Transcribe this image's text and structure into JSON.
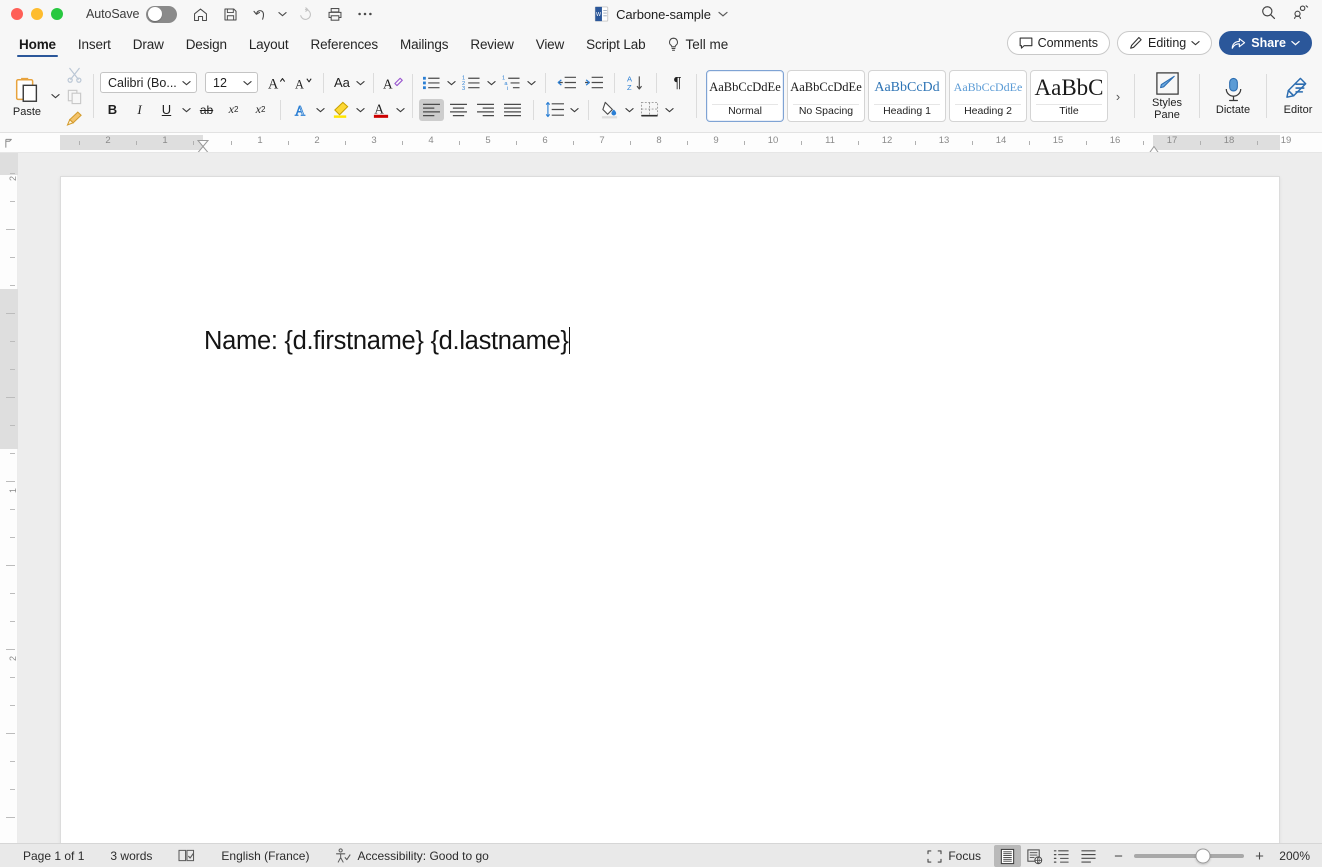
{
  "titlebar": {
    "autosave_label": "AutoSave",
    "autosave_state": "off",
    "document_title": "Carbone-sample",
    "quick_access": [
      {
        "name": "home-icon",
        "label": "Home"
      },
      {
        "name": "save-icon",
        "label": "Save"
      },
      {
        "name": "undo-icon",
        "label": "Undo"
      },
      {
        "name": "redo-icon",
        "label": "Redo"
      },
      {
        "name": "print-icon",
        "label": "Print"
      },
      {
        "name": "more-options-icon",
        "label": "More"
      }
    ],
    "search_label": "Search",
    "account_label": "Account"
  },
  "tabs": [
    {
      "label": "Home",
      "active": true
    },
    {
      "label": "Insert",
      "active": false
    },
    {
      "label": "Draw",
      "active": false
    },
    {
      "label": "Design",
      "active": false
    },
    {
      "label": "Layout",
      "active": false
    },
    {
      "label": "References",
      "active": false
    },
    {
      "label": "Mailings",
      "active": false
    },
    {
      "label": "Review",
      "active": false
    },
    {
      "label": "View",
      "active": false
    },
    {
      "label": "Script Lab",
      "active": false
    }
  ],
  "tellme": {
    "label": "Tell me"
  },
  "header_actions": {
    "comments_label": "Comments",
    "editing_label": "Editing",
    "share_label": "Share",
    "share_color": "#2b579a"
  },
  "ribbon": {
    "clipboard": {
      "paste_label": "Paste",
      "cut_label": "Cut",
      "copy_label": "Copy",
      "format_painter_label": "Format Painter"
    },
    "font": {
      "font_name": "Calibri (Bo...",
      "font_size": "12",
      "grow_label": "Grow Font",
      "shrink_label": "Shrink Font",
      "change_case_label": "Aa",
      "clear_formatting_label": "Clear Formatting",
      "bold_label": "B",
      "italic_label": "I",
      "underline_label": "U",
      "strikethrough_label": "ab",
      "subscript_label": "x",
      "subscript_sub": "2",
      "superscript_label": "x",
      "superscript_sup": "2",
      "text_effects_label": "A",
      "highlight_label": "Text Highlight Color",
      "highlight_color": "#ffe600",
      "font_color_label": "Font Color",
      "font_color": "#cc0000"
    },
    "paragraph": {
      "bullets_label": "Bullets",
      "numbering_label": "Numbering",
      "multilevel_label": "Multilevel List",
      "decrease_indent_label": "Decrease Indent",
      "increase_indent_label": "Increase Indent",
      "sort_label": "Sort",
      "show_marks_label": "¶",
      "align_left_label": "Align Left",
      "align_center_label": "Center",
      "align_right_label": "Align Right",
      "justify_label": "Justify",
      "line_spacing_label": "Line Spacing",
      "shading_label": "Shading",
      "borders_label": "Borders"
    },
    "styles": {
      "items": [
        {
          "preview": "AaBbCcDdEe",
          "caption": "Normal",
          "selected": true,
          "class": "p-normal"
        },
        {
          "preview": "AaBbCcDdEe",
          "caption": "No Spacing",
          "selected": false,
          "class": "p-nospace"
        },
        {
          "preview": "AaBbCcDd",
          "caption": "Heading 1",
          "selected": false,
          "class": "p-h1"
        },
        {
          "preview": "AaBbCcDdEe",
          "caption": "Heading 2",
          "selected": false,
          "class": "p-h2"
        },
        {
          "preview": "AaBbC",
          "caption": "Title",
          "selected": false,
          "class": "p-title"
        }
      ],
      "more_label": "›",
      "styles_pane_line1": "Styles",
      "styles_pane_line2": "Pane"
    },
    "dictate_label": "Dictate",
    "editor_label": "Editor"
  },
  "ruler": {
    "left_numbers": [
      "2",
      "1"
    ],
    "right_numbers": [
      "1",
      "2",
      "3",
      "4",
      "5",
      "6",
      "7",
      "8",
      "9",
      "10",
      "11",
      "12",
      "13",
      "14",
      "15",
      "16",
      "17",
      "18",
      "19"
    ]
  },
  "document": {
    "text": "Name: {d.firstname} {d.lastname}"
  },
  "statusbar": {
    "page_label": "Page 1 of 1",
    "words_label": "3 words",
    "proofing_label": "Proofing",
    "language_label": "English (France)",
    "accessibility_label": "Accessibility: Good to go",
    "focus_label": "Focus",
    "views": [
      {
        "name": "print-layout-view-button",
        "active": true
      },
      {
        "name": "web-layout-view-button",
        "active": false
      },
      {
        "name": "outline-view-button",
        "active": false
      },
      {
        "name": "draft-view-button",
        "active": false
      }
    ],
    "zoom_out_label": "−",
    "zoom_in_label": "+",
    "zoom_level": "200%"
  }
}
